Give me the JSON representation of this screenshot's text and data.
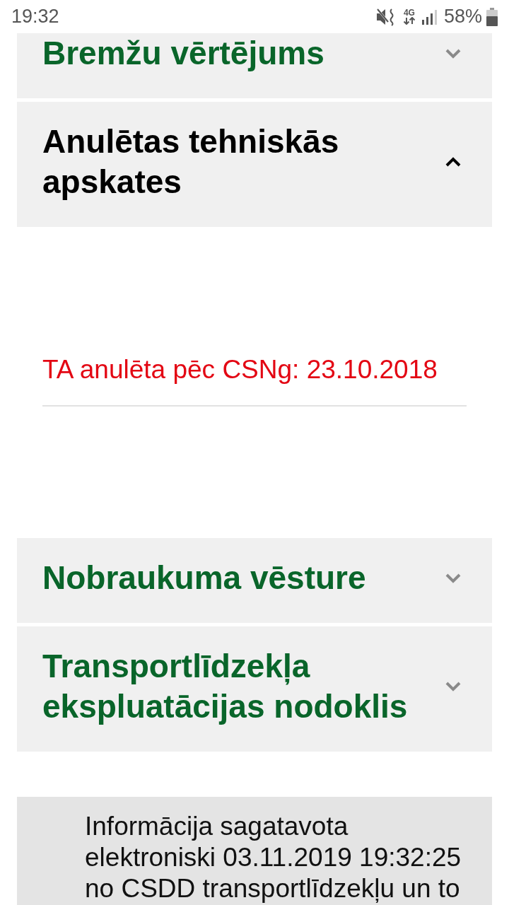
{
  "status_bar": {
    "time": "19:32",
    "network": "4G",
    "battery": "58%"
  },
  "sections": [
    {
      "title": "Bremžu vērtējums",
      "expanded": false
    },
    {
      "title": "Anulētas tehniskās apskates",
      "expanded": true,
      "content": [
        {
          "kind": "alert",
          "text": "TA anulēta pēc CSNg: 23.10.2018"
        }
      ]
    },
    {
      "title": "Nobraukuma vēsture",
      "expanded": false
    },
    {
      "title": "Transportlīdzekļa ekspluatācijas nodoklis",
      "expanded": false
    }
  ],
  "footer_note": "Informācija sagatavota elektroniski 03.11.2019 19:32:25 no CSDD transportlīdzekļu un to"
}
